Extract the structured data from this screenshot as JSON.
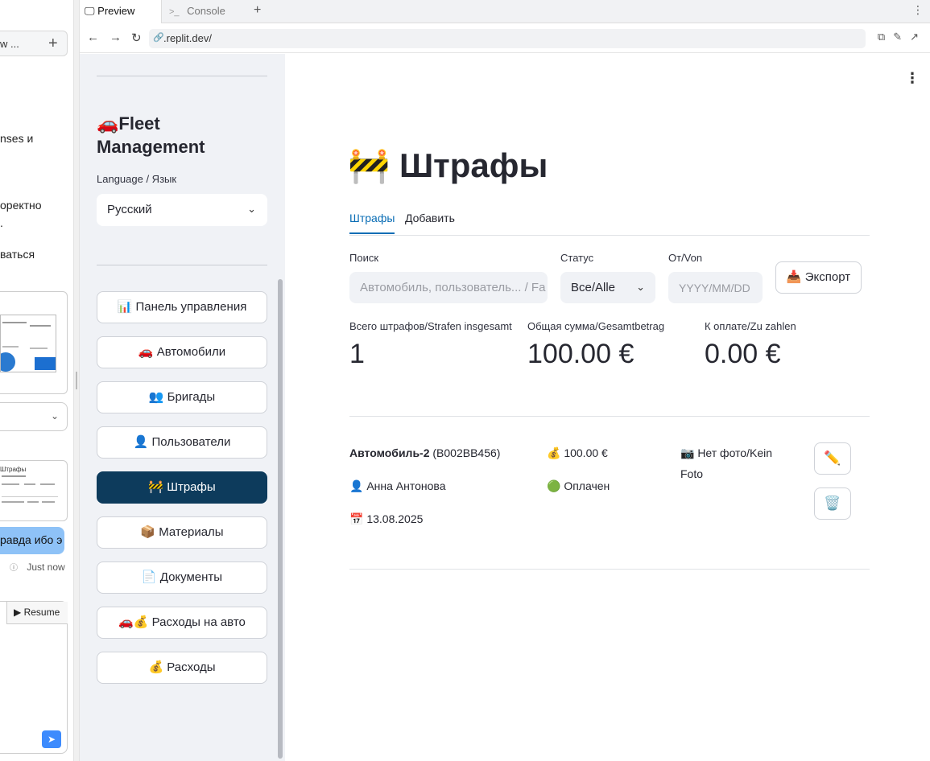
{
  "chat": {
    "title_fragment": "w ...",
    "lines": [
      "nses и",
      "оректно",
      ".",
      "ваться"
    ],
    "bubble_text": "равда ибо э",
    "time": "Just now",
    "resume_label": "Resume",
    "thumb_title": "Штрафы"
  },
  "browser": {
    "tabs": [
      {
        "label": "Preview"
      },
      {
        "label": "Console"
      }
    ],
    "url": ".replit.dev/"
  },
  "sidebar": {
    "app_title": "🚗Fleet Management",
    "language_label": "Language / Язык",
    "language_value": "Русский",
    "nav": [
      {
        "label": "📊 Панель управления",
        "active": false
      },
      {
        "label": "🚗 Автомобили",
        "active": false
      },
      {
        "label": "👥 Бригады",
        "active": false
      },
      {
        "label": "👤 Пользователи",
        "active": false
      },
      {
        "label": "🚧 Штрафы",
        "active": true
      },
      {
        "label": "📦 Материалы",
        "active": false
      },
      {
        "label": "📄 Документы",
        "active": false
      },
      {
        "label": "🚗💰 Расходы на авто",
        "active": false
      },
      {
        "label": "💰 Расходы",
        "active": false
      }
    ]
  },
  "main": {
    "title": "🚧 Штрафы",
    "tabs": [
      "Штрафы",
      "Добавить"
    ],
    "filters": {
      "search_label": "Поиск",
      "search_placeholder": "Автомобиль, пользователь... / Fa",
      "status_label": "Статус",
      "status_value": "Все/Alle",
      "from_label": "От/Von",
      "from_placeholder": "YYYY/MM/DD",
      "export_label": "📥 Экспорт"
    },
    "metrics": [
      {
        "label": "Всего штрафов/Strafen insgesamt",
        "value": "1"
      },
      {
        "label": "Общая сумма/Gesamtbetrag",
        "value": "100.00 €"
      },
      {
        "label": "К оплате/Zu zahlen",
        "value": "0.00 €"
      }
    ],
    "fine": {
      "vehicle_name": "Автомобиль-2",
      "vehicle_plate": "(B002BB456)",
      "user": "👤 Анна Антонова",
      "date": "📅 13.08.2025",
      "amount": "💰 100.00 €",
      "status": "🟢 Оплачен",
      "photo_line1": "📷 Нет фото/Kein",
      "photo_line2": "Foto",
      "edit_icon": "✏️",
      "delete_icon": "🗑️"
    }
  }
}
